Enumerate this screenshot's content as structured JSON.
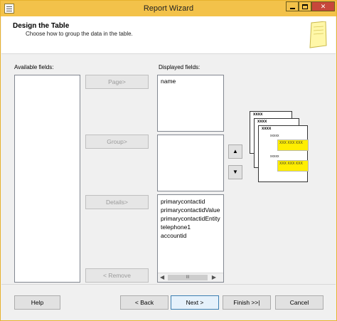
{
  "window": {
    "title": "Report Wizard",
    "icon": "document-icon"
  },
  "header": {
    "title": "Design the Table",
    "subtitle": "Choose how to group the data in the table."
  },
  "available_fields": {
    "label": "Available fields:",
    "items": []
  },
  "displayed_fields": {
    "label": "Displayed fields:"
  },
  "page_list": {
    "items": [
      "name"
    ]
  },
  "group_list": {
    "items": []
  },
  "details_list": {
    "items": [
      "primarycontactid",
      "primarycontactidValue",
      "primarycontactidEntityN",
      "telephone1",
      "accountid"
    ],
    "scroll_thumb": "III"
  },
  "move_buttons": {
    "page": "Page>",
    "group": "Group>",
    "details": "Details>",
    "remove": "< Remove",
    "up": "▲",
    "down": "▼"
  },
  "preview": {
    "header_labels": [
      "xxxx",
      "xxxx",
      "xxxx"
    ],
    "group_labels": [
      "xxxxx",
      "xxxxx"
    ],
    "detail_rows": [
      "XXX XXX XXX",
      "XXX XXX XXX"
    ]
  },
  "footer": {
    "help": "Help",
    "back": "< Back",
    "next": "Next >",
    "finish": "Finish >>|",
    "cancel": "Cancel"
  },
  "colors": {
    "titlebar": "#f3c24a",
    "close_button": "#c7473b",
    "preview_highlight": "#ffee00"
  }
}
